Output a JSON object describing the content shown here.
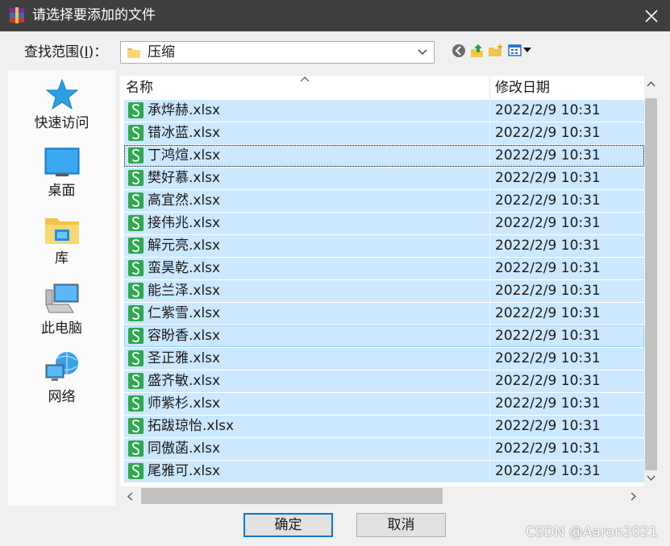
{
  "window": {
    "title": "请选择要添加的文件",
    "close_icon": "close-icon"
  },
  "lookin": {
    "label_prefix": "查找范围(",
    "label_mnemonic": "I",
    "label_suffix": ")：",
    "value": "压缩"
  },
  "toolbar": {
    "icons": [
      "back-icon",
      "up-folder-icon",
      "new-folder-icon",
      "view-menu-icon"
    ]
  },
  "places": [
    {
      "label": "快速访问",
      "icon": "star-icon"
    },
    {
      "label": "桌面",
      "icon": "desktop-icon"
    },
    {
      "label": "库",
      "icon": "library-icon"
    },
    {
      "label": "此电脑",
      "icon": "computer-icon"
    },
    {
      "label": "网络",
      "icon": "network-icon"
    }
  ],
  "columns": {
    "name": "名称",
    "date": "修改日期"
  },
  "files": [
    {
      "name": "承烨赫.xlsx",
      "date": "2022/2/9 10:31"
    },
    {
      "name": "错冰蓝.xlsx",
      "date": "2022/2/9 10:31"
    },
    {
      "name": "丁鸿煊.xlsx",
      "date": "2022/2/9 10:31"
    },
    {
      "name": "樊好慕.xlsx",
      "date": "2022/2/9 10:31"
    },
    {
      "name": "高宜然.xlsx",
      "date": "2022/2/9 10:31"
    },
    {
      "name": "接伟兆.xlsx",
      "date": "2022/2/9 10:31"
    },
    {
      "name": "解元亮.xlsx",
      "date": "2022/2/9 10:31"
    },
    {
      "name": "蛮昊乾.xlsx",
      "date": "2022/2/9 10:31"
    },
    {
      "name": "能兰泽.xlsx",
      "date": "2022/2/9 10:31"
    },
    {
      "name": "仁紫雪.xlsx",
      "date": "2022/2/9 10:31"
    },
    {
      "name": "容盼香.xlsx",
      "date": "2022/2/9 10:31"
    },
    {
      "name": "圣正雅.xlsx",
      "date": "2022/2/9 10:31"
    },
    {
      "name": "盛齐敏.xlsx",
      "date": "2022/2/9 10:31"
    },
    {
      "name": "师紫杉.xlsx",
      "date": "2022/2/9 10:31"
    },
    {
      "name": "拓跋琼怡.xlsx",
      "date": "2022/2/9 10:31"
    },
    {
      "name": "同傲菡.xlsx",
      "date": "2022/2/9 10:31"
    },
    {
      "name": "尾雅可.xlsx",
      "date": "2022/2/9 10:31"
    }
  ],
  "buttons": {
    "ok": "确定",
    "cancel": "取消"
  },
  "watermark": "CSDN @Aaron2021",
  "colors": {
    "titlebar": "#3f3f40",
    "selection": "#cce8ff",
    "accent": "#0078d7",
    "xlsx_icon": "#2fa84f"
  }
}
